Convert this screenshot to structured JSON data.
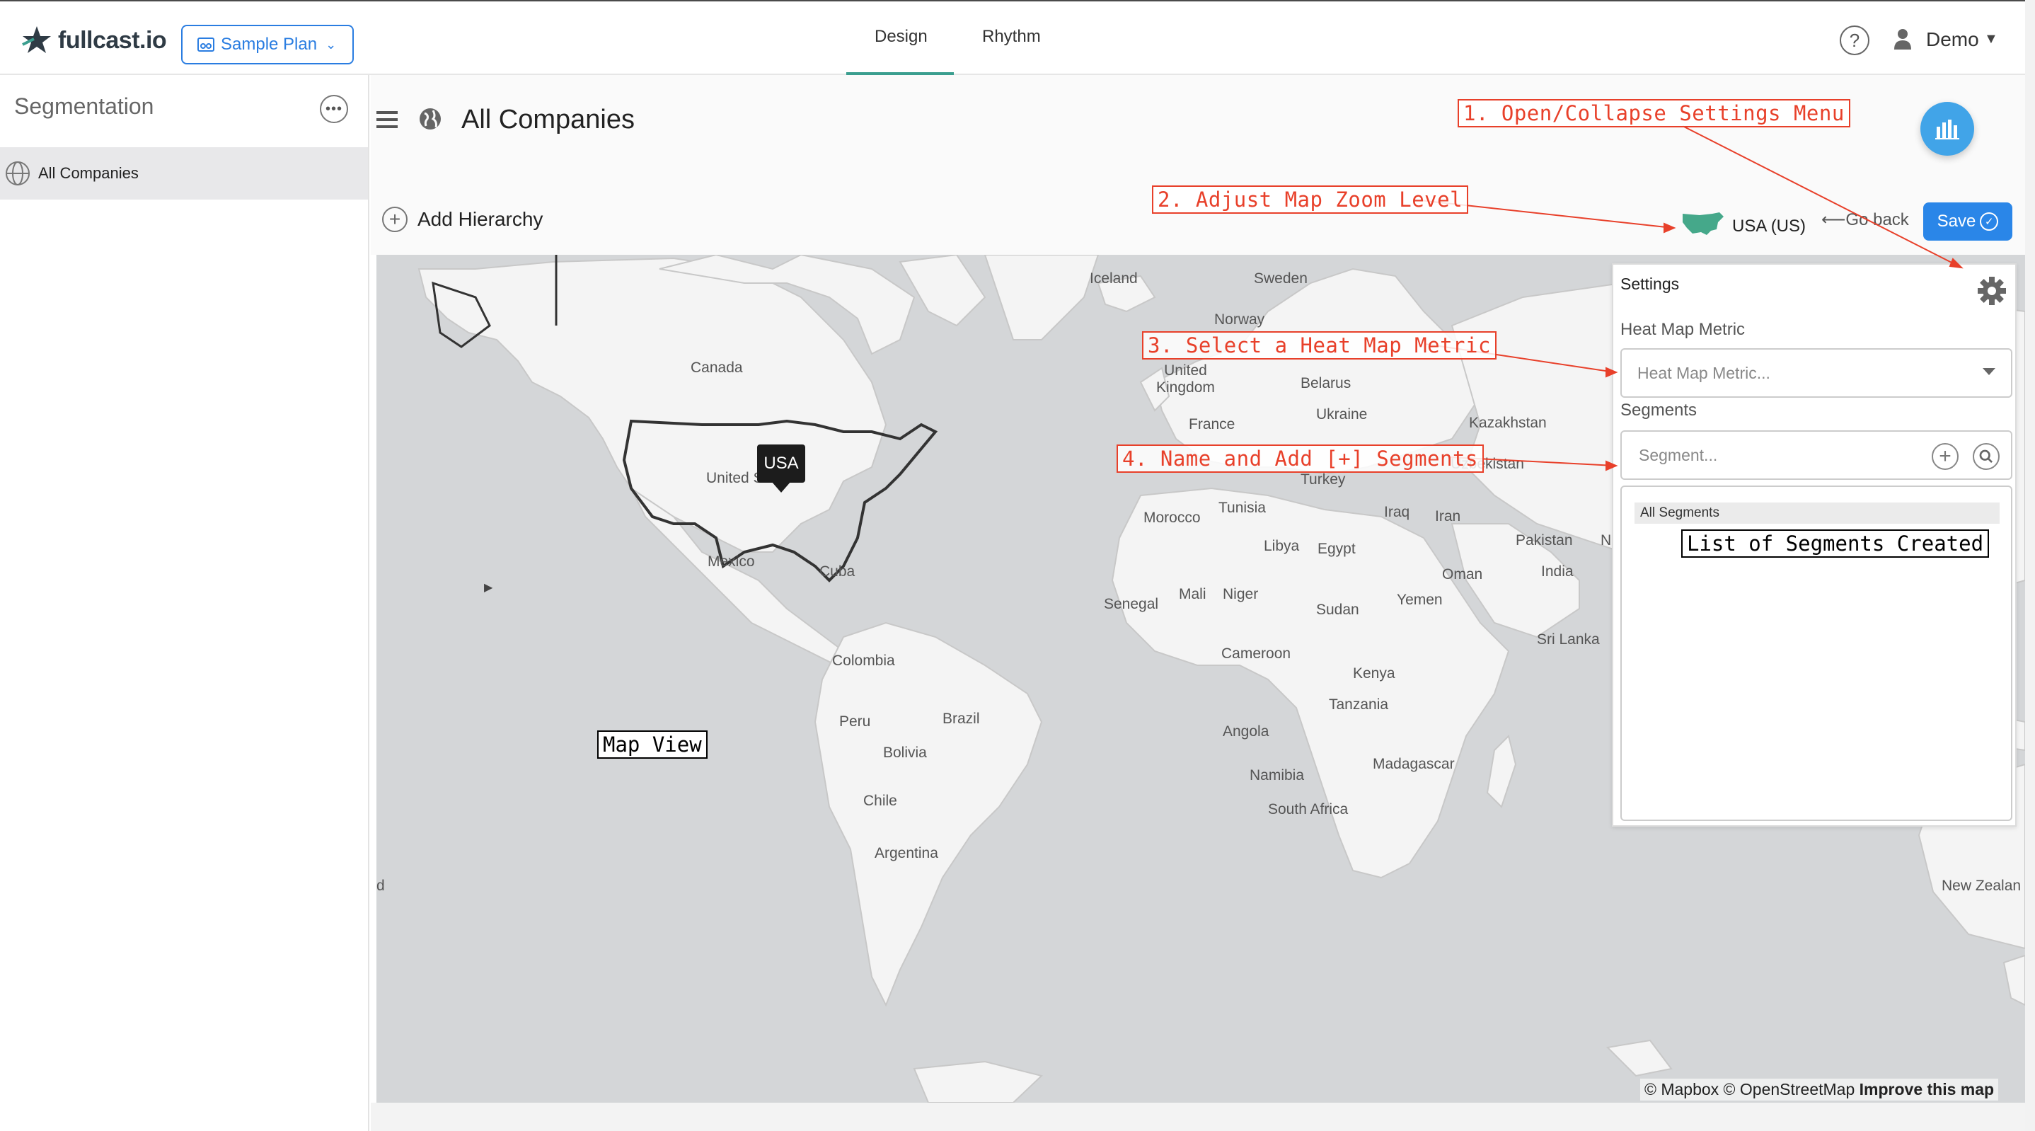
{
  "header": {
    "logo_text": "fullcast.io",
    "plan_selector": "Sample Plan",
    "tabs": [
      {
        "label": "Design",
        "active": true
      },
      {
        "label": "Rhythm",
        "active": false
      }
    ],
    "help_icon": "?",
    "user_name": "Demo",
    "accent_color": "#2a86e8",
    "active_tab_color": "#3a9e8f"
  },
  "sidebar": {
    "title": "Segmentation",
    "items": [
      {
        "label": "All Companies",
        "selected": true
      }
    ]
  },
  "main": {
    "title": "All Companies",
    "add_hierarchy": "Add Hierarchy",
    "zoom_region": "USA (US)",
    "go_back": "⟵Go back",
    "save": "Save"
  },
  "map": {
    "labels": {
      "iceland": "Iceland",
      "sweden": "Sweden",
      "norway": "Norway",
      "canada": "Canada",
      "uk": "United\nKingdom",
      "belarus": "Belarus",
      "ukraine": "Ukraine",
      "france": "France",
      "kazakhstan": "Kazakhstan",
      "united": "United S",
      "uzbekistan": "Uzbekistan",
      "turkey": "Turkey",
      "tunisia": "Tunisia",
      "morocco": "Morocco",
      "iraq": "Iraq",
      "iran": "Iran",
      "mexico": "Mexico",
      "cuba": "Cuba",
      "libya": "Libya",
      "egypt": "Egypt",
      "pakistan": "Pakistan",
      "nepal": "Nepal",
      "india": "India",
      "oman": "Oman",
      "mali": "Mali",
      "niger": "Niger",
      "senegal": "Senegal",
      "yemen": "Yemen",
      "sudan": "Sudan",
      "srilanka": "Sri Lanka",
      "colombia": "Colombia",
      "cameroon": "Cameroon",
      "kenya": "Kenya",
      "brazil": "Brazil",
      "peru": "Peru",
      "tanzania": "Tanzania",
      "bolivia": "Bolivia",
      "angola": "Angola",
      "madagascar": "Madagascar",
      "namibia": "Namibia",
      "chile": "Chile",
      "southafrica": "South Africa",
      "argentina": "Argentina",
      "newzealand": "New Zealan",
      "edge": "d"
    },
    "marker": "USA",
    "attribution_1": "© Mapbox © OpenStreetMap",
    "attribution_2": "Improve this map"
  },
  "settings": {
    "title": "Settings",
    "heat_map_label": "Heat Map Metric",
    "heat_map_placeholder": "Heat Map Metric...",
    "segments_label": "Segments",
    "segment_placeholder": "Segment...",
    "all_segments": "All Segments"
  },
  "annotations": {
    "a1": "1. Open/Collapse Settings Menu",
    "a2": "2. Adjust Map Zoom Level",
    "a3": "3. Select a Heat Map Metric",
    "a4": "4. Name and Add [+] Segments",
    "list": "List of Segments Created",
    "map_view": "Map View",
    "color": "#e8402a"
  }
}
